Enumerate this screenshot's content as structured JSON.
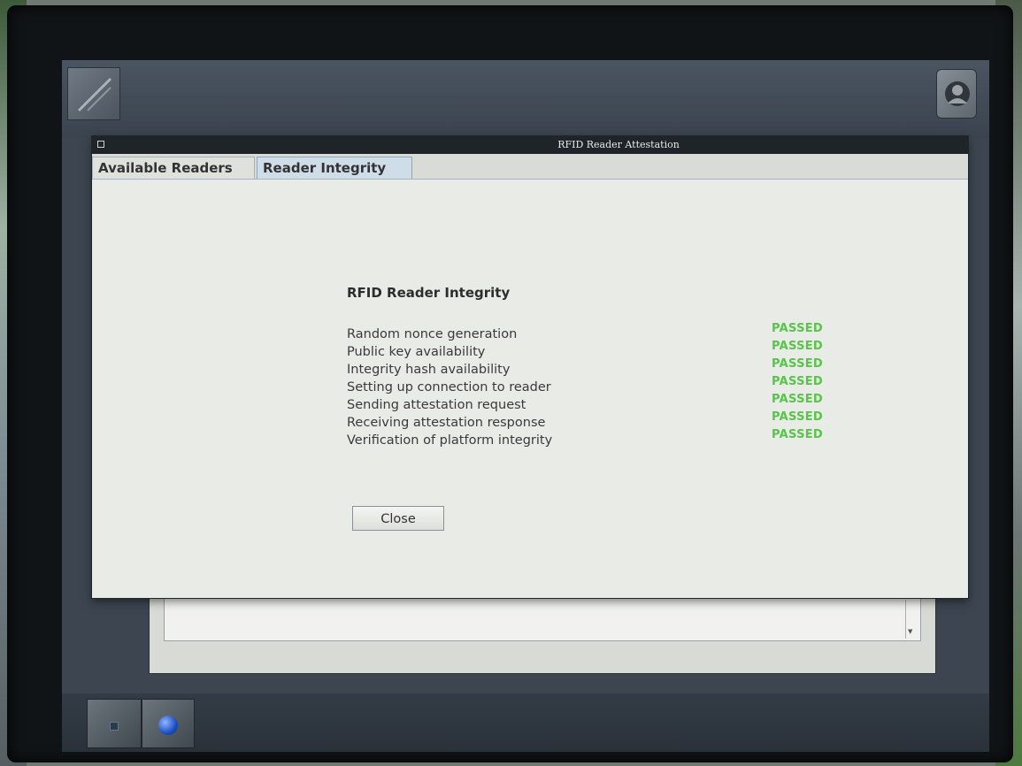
{
  "window": {
    "title": "RFID Reader Attestation"
  },
  "tabs": [
    {
      "label": "Available Readers",
      "active": false
    },
    {
      "label": "Reader Integrity",
      "active": true
    }
  ],
  "integrity": {
    "heading": "RFID Reader Integrity",
    "checks": [
      {
        "label": "Random nonce generation",
        "status": "PASSED"
      },
      {
        "label": "Public key availability",
        "status": "PASSED"
      },
      {
        "label": "Integrity hash availability",
        "status": "PASSED"
      },
      {
        "label": "Setting up connection to reader",
        "status": "PASSED"
      },
      {
        "label": "Sending attestation request",
        "status": "PASSED"
      },
      {
        "label": "Receiving attestation response",
        "status": "PASSED"
      },
      {
        "label": "Verification of platform integrity",
        "status": "PASSED"
      }
    ],
    "close_label": "Close"
  },
  "colors": {
    "passed": "#58c44a",
    "active_tab": "#cfdde9",
    "titlebar": "#1e2428"
  },
  "icons": {
    "top_left": "edit-tool-icon",
    "top_right": "user-icon",
    "dock_1": "small-square-icon",
    "dock_2": "blue-orb-icon"
  }
}
